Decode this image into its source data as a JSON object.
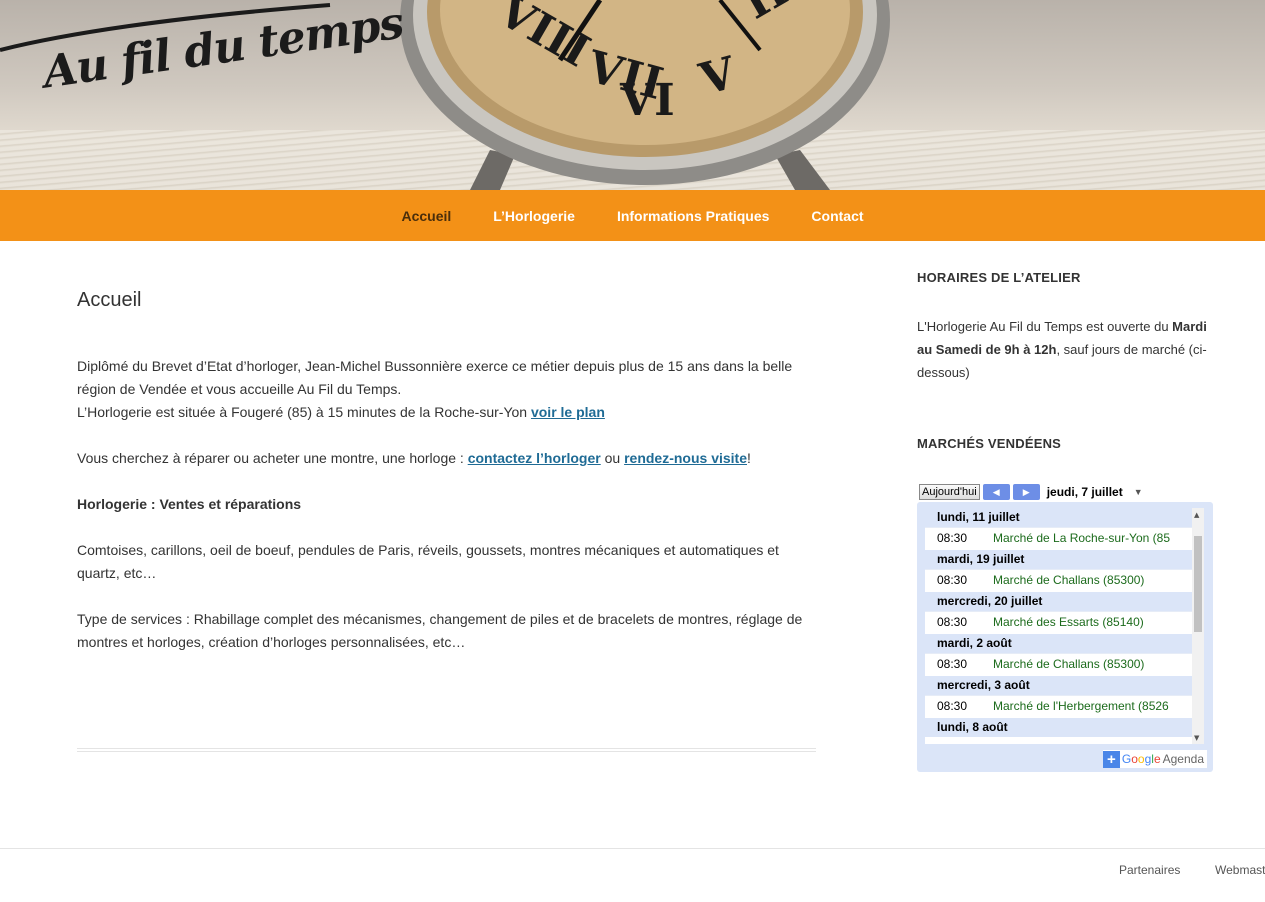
{
  "header": {
    "logo_text": "Au fil du temps"
  },
  "nav": {
    "items": [
      "Accueil",
      "L’Horlogerie",
      "Informations Pratiques",
      "Contact"
    ]
  },
  "main": {
    "title": "Accueil",
    "p1_text": "Diplômé du Brevet d’Etat d’horloger, Jean-Michel Bussonnière exerce ce métier depuis plus de 15 ans dans la belle région de Vendée et vous accueille Au Fil du Temps.",
    "p1_line2": "L’Horlogerie est située à Fougeré (85) à 15 minutes de la Roche-sur-Yon ",
    "p1_link": "voir le plan",
    "p2_text": "Vous cherchez à réparer ou acheter une montre, une horloge : ",
    "p2_link1": "contactez l’horloger",
    "p2_mid": " ou ",
    "p2_link2": "rendez-nous visite",
    "p2_end": "!",
    "p3_bold": "Horlogerie : Ventes et réparations",
    "p4_text": "Comtoises, carillons, oeil de boeuf, pendules de Paris, réveils, goussets, montres mécaniques et automatiques et quartz, etc…",
    "p5_text": "Type de services : Rhabillage complet des mécanismes, changement de piles et de bracelets de montres, réglage de montres et horloges, création d’horloges personnalisées, etc…"
  },
  "sidebar": {
    "hours_title": "HORAIRES DE L’ATELIER",
    "hours_text_1": "L'Horlogerie Au Fil du Temps est ouverte du ",
    "hours_bold": "Mardi au Samedi de 9h à 12h",
    "hours_text_2": ", sauf jours de marché (ci-dessous)",
    "markets_title": "MARCHÉS VENDÉENS"
  },
  "calendar": {
    "today_label": "Aujourd'hui",
    "current_date": "jeudi, 7 juillet",
    "days": [
      {
        "label": "lundi, 11 juillet",
        "time": "08:30",
        "event": "Marché de La Roche-sur-Yon (85"
      },
      {
        "label": "mardi, 19 juillet",
        "time": "08:30",
        "event": "Marché de Challans (85300)"
      },
      {
        "label": "mercredi, 20 juillet",
        "time": "08:30",
        "event": "Marché des Essarts (85140)"
      },
      {
        "label": "mardi, 2 août",
        "time": "08:30",
        "event": "Marché de Challans (85300)"
      },
      {
        "label": "mercredi, 3 août",
        "time": "08:30",
        "event": "Marché de l'Herbergement (8526"
      },
      {
        "label": "lundi, 8 août",
        "time": "",
        "event": ""
      }
    ],
    "brand_google": "Google",
    "brand_agenda": "Agenda"
  },
  "footer": {
    "link1": "Partenaires",
    "link2": "Webmast"
  }
}
